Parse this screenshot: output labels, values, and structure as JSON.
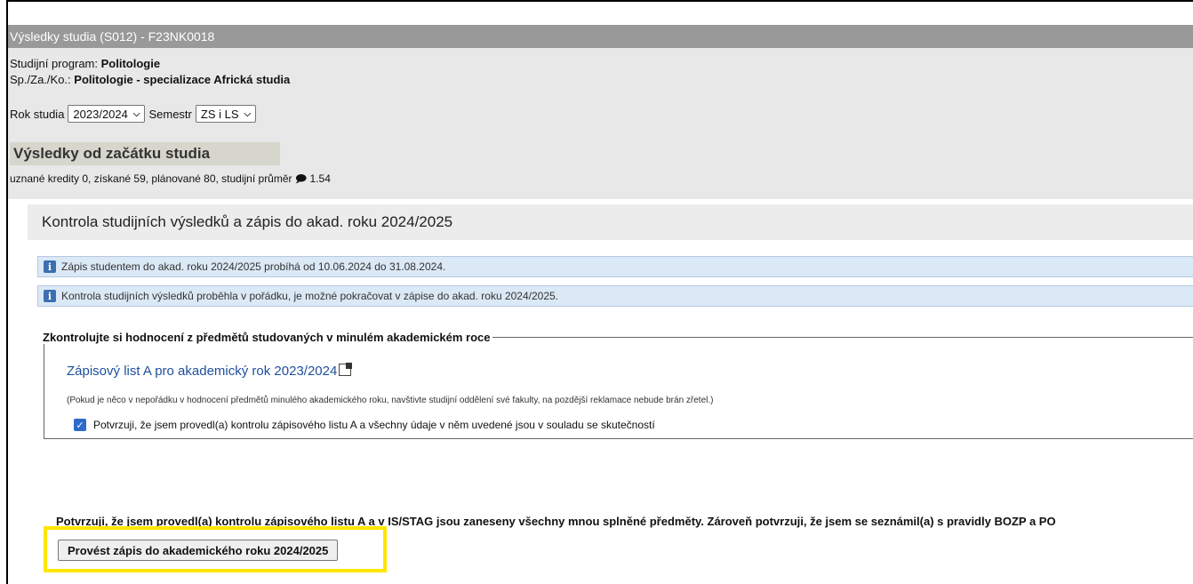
{
  "window_title": "Výsledky studia (S012) - F23NK0018",
  "study": {
    "program_label": "Studijní program:",
    "program_value": "Politologie",
    "spec_label": "Sp./Za./Ko.:",
    "spec_value": "Politologie - specializace Africká studia"
  },
  "filters": {
    "year_label": "Rok studia",
    "year_value": "2023/2024",
    "semester_label": "Semestr",
    "semester_value": "ZS i LS"
  },
  "results": {
    "title": "Výsledky od začátku studia",
    "summary": "uznané kredity 0, získané 59, plánované 80, studijní průměr",
    "average_icon": "comment-icon",
    "average": "1.54"
  },
  "kontrola": {
    "title": "Kontrola studijních výsledků a zápis do akad. roku 2024/2025",
    "info1": "Zápis studentem do akad. roku 2024/2025 probíhá od 10.06.2024 do 31.08.2024.",
    "info2": "Kontrola studijních výsledků proběhla v pořádku, je možné pokračovat v zápise do akad. roku 2024/2025."
  },
  "check_box": {
    "legend": "Zkontrolujte si hodnocení z předmětů studovaných v minulém akademickém roce",
    "link": "Zápisový list A pro akademický rok 2023/2024",
    "note": "(Pokud je něco v nepořádku v hodnocení předmětů minulého akademického roku, navštivte studijní oddělení své fakulty, na pozdější reklamace nebude brán zřetel.)",
    "confirm_label": "Potvrzuji, že jsem provedl(a) kontrolu zápisového listu A a všechny údaje v něm uvedené jsou v souladu se skutečností",
    "checked": true
  },
  "bottom_text": "Potvrzuji, že jsem provedl(a) kontrolu zápisového listu A a v IS/STAG jsou zaneseny všechny mnou splněné předměty. Zároveň potvrzuji, že jsem se seznámil(a) s pravidly BOZP a PO",
  "submit_button": "Provést zápis do akademického roku 2024/2025",
  "colors": {
    "highlight": "#ffe600",
    "link": "#1f4f9b",
    "titlebar": "#999999"
  }
}
